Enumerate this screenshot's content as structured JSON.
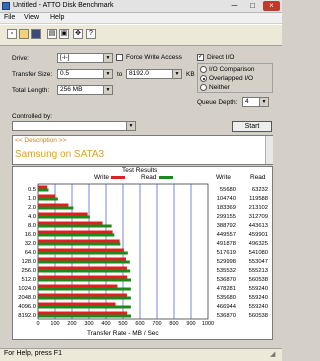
{
  "window": {
    "title": "Untitled - ATTO Disk Benchmark",
    "minimize": "─",
    "maximize": "□",
    "close": "×"
  },
  "menu": [
    "File",
    "View",
    "Help"
  ],
  "toolbar": {
    "icons": [
      "new-icon",
      "open-icon",
      "save-icon",
      "print-icon",
      "print-preview-icon",
      "move-icon",
      "help-icon"
    ]
  },
  "settings": {
    "drive_label": "Drive:",
    "drive_value": "[-i-]",
    "force_write_access": "Force Write Access",
    "direct_io": "Direct I/O",
    "transfer_size_label": "Transfer Size:",
    "transfer_from": "0.5",
    "to_label": "to",
    "transfer_to": "8192.0",
    "kb_label": "KB",
    "total_length_label": "Total Length:",
    "total_length_value": "256 MB",
    "io_comparison": "I/O Comparison",
    "overlapped_io": "Overlapped I/O",
    "neither": "Neither",
    "queue_depth_label": "Queue Depth:",
    "queue_depth_value": "4",
    "controlled_by_label": "Controlled by:",
    "start_button": "Start"
  },
  "description": {
    "header": "<< Description >>",
    "text": "Samsung on SATA3"
  },
  "results": {
    "title": "Test Results",
    "write_legend": "Write",
    "read_legend": "Read",
    "write_col": "Write",
    "read_col": "Read",
    "write_color": "#e02020",
    "read_color": "#1a8a1a",
    "rows": [
      {
        "label": "0.5",
        "write": "55680",
        "read": "63232"
      },
      {
        "label": "1.0",
        "write": "104740",
        "read": "119588"
      },
      {
        "label": "2.0",
        "write": "183369",
        "read": "213102"
      },
      {
        "label": "4.0",
        "write": "299155",
        "read": "312709"
      },
      {
        "label": "8.0",
        "write": "388792",
        "read": "443613"
      },
      {
        "label": "16.0",
        "write": "449557",
        "read": "459901"
      },
      {
        "label": "32.0",
        "write": "491878",
        "read": "496325"
      },
      {
        "label": "64.0",
        "write": "517619",
        "read": "541080"
      },
      {
        "label": "128.0",
        "write": "529998",
        "read": "553047"
      },
      {
        "label": "256.0",
        "write": "535532",
        "read": "555213"
      },
      {
        "label": "512.0",
        "write": "536870",
        "read": "560538"
      },
      {
        "label": "1024.0",
        "write": "478281",
        "read": "559240"
      },
      {
        "label": "2048.0",
        "write": "535680",
        "read": "559240"
      },
      {
        "label": "4096.0",
        "write": "466944",
        "read": "559240"
      },
      {
        "label": "8192.0",
        "write": "536870",
        "read": "560538"
      }
    ]
  },
  "chart_data": {
    "type": "bar",
    "title": "Test Results",
    "xlabel": "Transfer Rate - MB / Sec",
    "ylabel": "",
    "xlim": [
      0,
      1000
    ],
    "x_ticks": [
      "0",
      "100",
      "200",
      "300",
      "400",
      "500",
      "600",
      "700",
      "800",
      "900",
      "1000"
    ],
    "categories": [
      "0.5",
      "1.0",
      "2.0",
      "4.0",
      "8.0",
      "16.0",
      "32.0",
      "64.0",
      "128.0",
      "256.0",
      "512.0",
      "1024.0",
      "2048.0",
      "4096.0",
      "8192.0"
    ],
    "series": [
      {
        "name": "Write",
        "values": [
          54.4,
          102.3,
          179.1,
          292.1,
          379.7,
          439.0,
          480.4,
          505.5,
          517.6,
          523.0,
          524.3,
          467.1,
          523.1,
          456.0,
          524.3
        ]
      },
      {
        "name": "Read",
        "values": [
          61.8,
          116.8,
          208.1,
          305.4,
          433.2,
          449.1,
          484.7,
          528.4,
          540.1,
          542.2,
          547.4,
          546.1,
          546.1,
          546.1,
          547.4
        ]
      }
    ]
  },
  "status": {
    "text": "For Help, press F1"
  }
}
